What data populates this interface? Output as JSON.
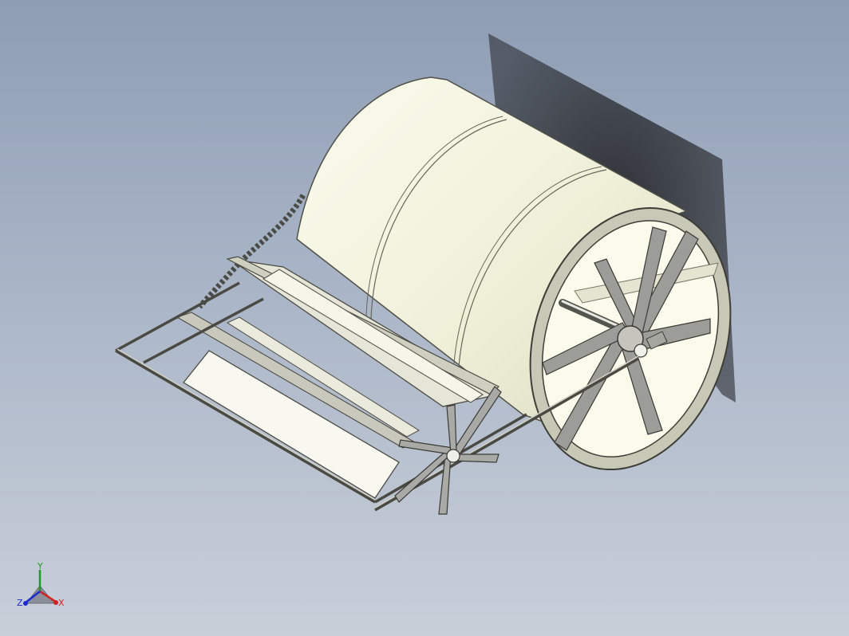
{
  "viewport": {
    "background_top": "#8e9db4",
    "background_bottom": "#c9cfd9"
  },
  "model": {
    "drum_color": "#f4f4de",
    "frame_color": "#b9b9ad",
    "spoke_color": "#9fa09c",
    "shadow_color": "#2d2f33"
  },
  "triad": {
    "x_label": "X",
    "y_label": "Y",
    "z_label": "Z",
    "x_color": "#d42020",
    "y_color": "#1f9a2a",
    "z_color": "#1c2ad1"
  }
}
